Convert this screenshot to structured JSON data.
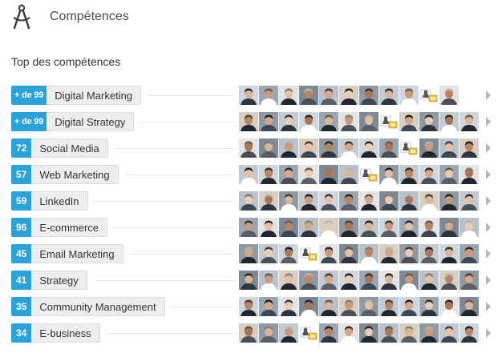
{
  "header": {
    "icon": "compass-drafting-icon",
    "title": "Compétences"
  },
  "section": {
    "subtitle": "Top des compétences"
  },
  "skills": [
    {
      "count": "+ de 99",
      "name": "Digital Marketing",
      "endorsers": [
        "person",
        "person",
        "person",
        "person",
        "person",
        "person",
        "person",
        "person",
        "person",
        "placeholder",
        "person"
      ]
    },
    {
      "count": "+ de 99",
      "name": "Digital Strategy",
      "endorsers": [
        "person",
        "person",
        "person",
        "person",
        "person",
        "person",
        "person",
        "placeholder",
        "person",
        "person",
        "person",
        "person"
      ]
    },
    {
      "count": "72",
      "name": "Social Media",
      "endorsers": [
        "person",
        "person",
        "person",
        "person",
        "person",
        "person",
        "person",
        "person",
        "placeholder",
        "person",
        "person",
        "person"
      ]
    },
    {
      "count": "57",
      "name": "Web Marketing",
      "endorsers": [
        "person",
        "person",
        "person",
        "person",
        "person",
        "person",
        "placeholder",
        "person",
        "person",
        "person",
        "person",
        "person"
      ]
    },
    {
      "count": "59",
      "name": "LinkedIn",
      "endorsers": [
        "person",
        "person",
        "person",
        "person",
        "person",
        "person",
        "person",
        "person",
        "person",
        "person",
        "person",
        "person"
      ]
    },
    {
      "count": "96",
      "name": "E-commerce",
      "endorsers": [
        "person",
        "person",
        "person",
        "person",
        "person",
        "person",
        "person",
        "person",
        "person",
        "person",
        "person",
        "person"
      ]
    },
    {
      "count": "45",
      "name": "Email Marketing",
      "endorsers": [
        "person",
        "person",
        "person",
        "placeholder",
        "person",
        "person",
        "person",
        "person",
        "person",
        "person",
        "person",
        "person"
      ]
    },
    {
      "count": "41",
      "name": "Strategy",
      "endorsers": [
        "person",
        "person",
        "person",
        "person",
        "person",
        "person",
        "person",
        "person",
        "person",
        "person",
        "person",
        "person"
      ]
    },
    {
      "count": "35",
      "name": "Community Management",
      "endorsers": [
        "person",
        "person",
        "person",
        "person",
        "person",
        "person",
        "person",
        "person",
        "person",
        "person",
        "person",
        "person"
      ]
    },
    {
      "count": "34",
      "name": "E-business",
      "endorsers": [
        "person",
        "person",
        "person",
        "placeholder",
        "person",
        "person",
        "person",
        "person",
        "person",
        "person",
        "person",
        "person"
      ]
    }
  ],
  "row_arrow_icon": "chevron-right-icon",
  "colors": {
    "count_badge": "#2aa3dd",
    "skill_pill": "#eeeeee",
    "line": "#e6e6e6",
    "arrow": "#b5b5b5"
  }
}
